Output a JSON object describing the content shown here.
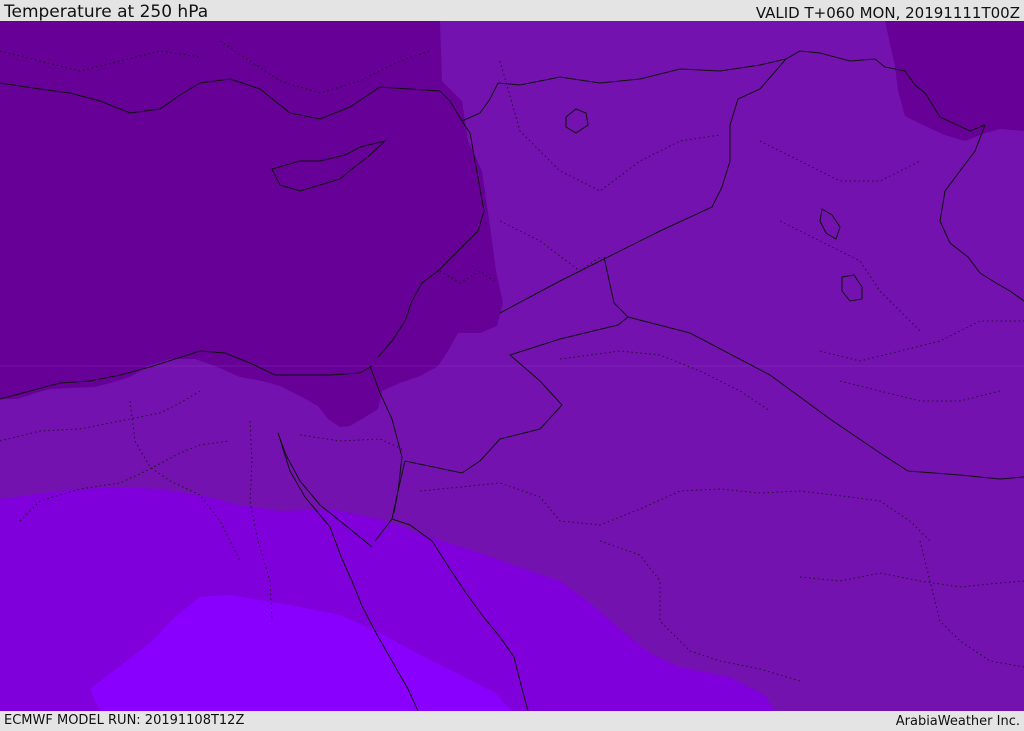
{
  "header": {
    "title": "Temperature at 250 hPa",
    "valid": "VALID T+060 MON, 20191111T00Z"
  },
  "footer": {
    "model_run": "ECMWF MODEL RUN: 20191108T12Z",
    "credit": "ArabiaWeather Inc."
  },
  "colors": {
    "coldest_band": "#660097",
    "cold_band": "#7412b0",
    "mid_band": "#8000dc",
    "warm_band": "#8a00ff",
    "borders": "#111111"
  }
}
